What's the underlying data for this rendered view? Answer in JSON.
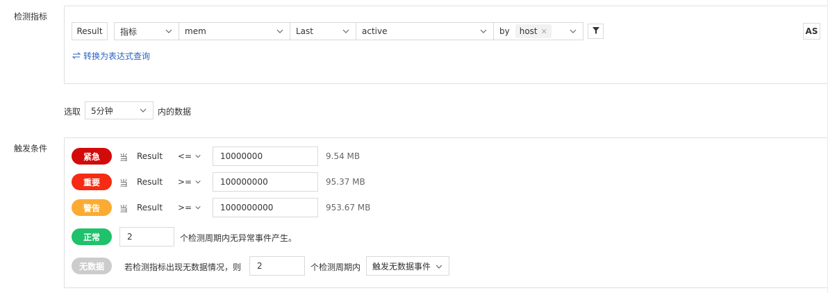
{
  "metric_section": {
    "label": "检测指标",
    "result_btn": "Result",
    "type_select": "指标",
    "metric_select": "mem",
    "agg_select": "Last",
    "field_select": "active",
    "by_label": "by",
    "group_tag": "host",
    "as_btn": "AS",
    "convert_link": "转换为表达式查询",
    "filter_icon": "filter-icon"
  },
  "window": {
    "prefix": "选取",
    "value": "5分钟",
    "suffix": "内的数据"
  },
  "trigger_section": {
    "label": "触发条件",
    "rules": [
      {
        "level": "紧急",
        "color": "#d20a0a",
        "when": "当",
        "target": "Result",
        "op": "<=",
        "value": "10000000",
        "hint": "9.54 MB"
      },
      {
        "level": "重要",
        "color": "#f52b13",
        "when": "当",
        "target": "Result",
        "op": ">=",
        "value": "100000000",
        "hint": "95.37 MB"
      },
      {
        "level": "警告",
        "color": "#fbab32",
        "when": "当",
        "target": "Result",
        "op": ">=",
        "value": "1000000000",
        "hint": "953.67 MB"
      }
    ],
    "normal": {
      "level": "正常",
      "color": "#1fc16b",
      "value": "2",
      "text": "个检测周期内无异常事件产生。"
    },
    "nodata": {
      "level": "无数据",
      "color": "#cccccc",
      "prefix": "若检测指标出现无数据情况，则",
      "value": "2",
      "middle": "个检测周期内",
      "action": "触发无数据事件"
    }
  }
}
